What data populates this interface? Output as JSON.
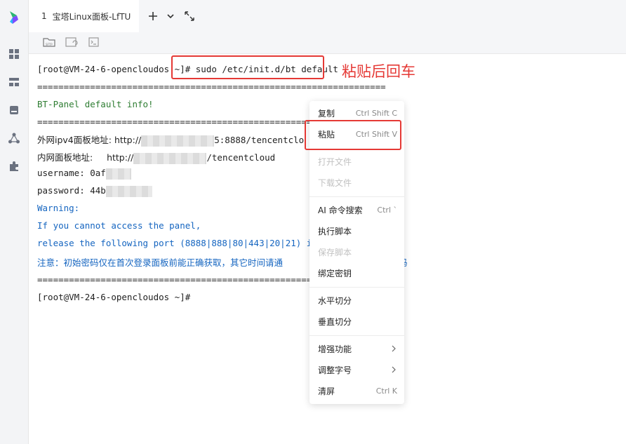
{
  "colors": {
    "accent_red": "#e53935",
    "green_text": "#2e7d32",
    "blue_text": "#1565c0",
    "sidebar_bg": "#f3f4f6"
  },
  "tabs": [
    {
      "index": "1",
      "label": "宝塔Linux面板-LfTU"
    }
  ],
  "tab_controls": {
    "add": "+",
    "dropdown": "⌄",
    "expand": "⤡"
  },
  "toolbar": {
    "sftp_label": "SFTP",
    "sync_label": "",
    "script_label": ""
  },
  "terminal": {
    "prompt": "[root@VM-24-6-opencloudos ~]",
    "command": "# sudo /etc/init.d/bt default",
    "separator": "==================================================================",
    "info_title": "BT-Panel default info!",
    "ext_label": "外网ipv4面板地址: http://",
    "ext_suffix": "5:8888/tencentclo",
    "int_label": "内网面板地址:     http://",
    "int_suffix": "/tencentcloud",
    "username_label": "username: 0af",
    "password_label": "password: 44b",
    "warning": "Warning:",
    "warn_line1": "If you cannot access the panel,",
    "warn_line2": "release the following port (8888|888|80|443|20|21) in th",
    "note_line1": "注意：初始密码仅在首次登录面板前能正确获取，其它时间请通",
    "note_line2": "码",
    "final_prompt": "[root@VM-24-6-opencloudos ~]#"
  },
  "annotation": "粘贴后回车",
  "context_menu": {
    "copy": {
      "label": "复制",
      "shortcut": "Ctrl Shift C"
    },
    "paste": {
      "label": "粘贴",
      "shortcut": "Ctrl Shift V"
    },
    "open_file": "打开文件",
    "download_file": "下载文件",
    "ai_search": {
      "label": "AI 命令搜索",
      "shortcut": "Ctrl `"
    },
    "run_script": "执行脚本",
    "save_script": "保存脚本",
    "bind_key": "绑定密钥",
    "split_h": "水平切分",
    "split_v": "垂直切分",
    "enhance": "增强功能",
    "font_size": "调整字号",
    "clear": {
      "label": "清屏",
      "shortcut": "Ctrl K"
    }
  }
}
